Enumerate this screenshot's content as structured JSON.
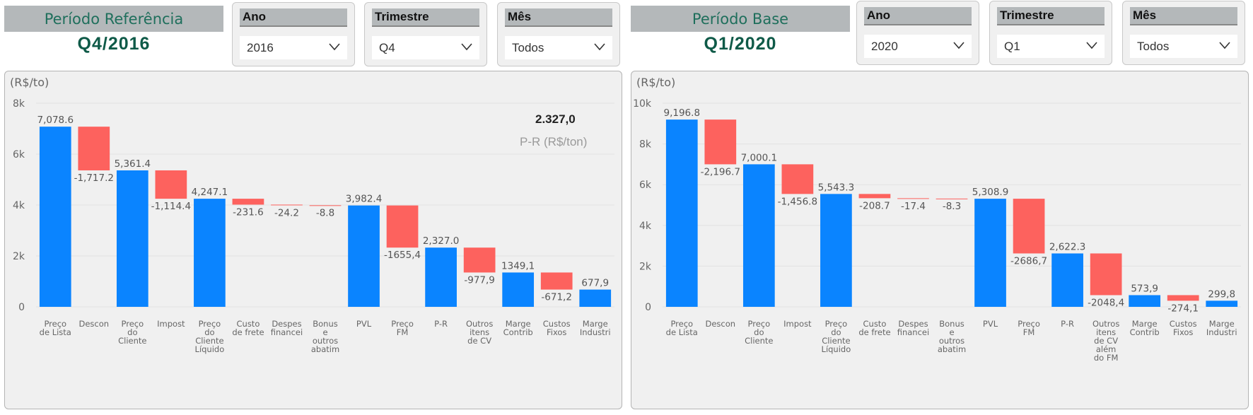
{
  "colors": {
    "increase": "#0a84ff",
    "decrease": "#fd625e",
    "title_bg": "#b4b8ba"
  },
  "left": {
    "title": "Período Referência",
    "period": "Q4/2016",
    "slicers": [
      {
        "header": "Ano",
        "value": "2016"
      },
      {
        "header": "Trimestre",
        "value": "Q4"
      },
      {
        "header": "Mês",
        "value": "Todos"
      }
    ],
    "kpi": {
      "value": "2.327,0",
      "label": "P-R (R$/ton)"
    }
  },
  "right": {
    "title": "Período Base",
    "period": "Q1/2020",
    "slicers": [
      {
        "header": "Ano",
        "value": "2020"
      },
      {
        "header": "Trimestre",
        "value": "Q1"
      },
      {
        "header": "Mês",
        "value": "Todos"
      }
    ]
  },
  "chart_data": [
    {
      "type": "waterfall",
      "unit_label": "(R$/to)",
      "ylim": [
        0,
        8000
      ],
      "yticks": [
        {
          "v": 0,
          "label": "0"
        },
        {
          "v": 2000,
          "label": "2k"
        },
        {
          "v": 4000,
          "label": "4k"
        },
        {
          "v": 6000,
          "label": "6k"
        },
        {
          "v": 8000,
          "label": "8k"
        }
      ],
      "grid": true,
      "bars": [
        {
          "category": [
            "Preço",
            "de Lista"
          ],
          "kind": "total",
          "value": 7078.6,
          "label": "7,078.6"
        },
        {
          "category": [
            "Descon"
          ],
          "kind": "delta",
          "value": -1717.2,
          "label": "-1,717.2"
        },
        {
          "category": [
            "Preço",
            "do",
            "Cliente"
          ],
          "kind": "total",
          "value": 5361.4,
          "label": "5,361.4"
        },
        {
          "category": [
            "Impost"
          ],
          "kind": "delta",
          "value": -1114.4,
          "label": "-1,114.4"
        },
        {
          "category": [
            "Preço",
            "do",
            "Cliente",
            "Líquido"
          ],
          "kind": "total",
          "value": 4247.1,
          "label": "4,247.1"
        },
        {
          "category": [
            "Custo",
            "de frete"
          ],
          "kind": "delta",
          "value": -231.6,
          "label": "-231.6"
        },
        {
          "category": [
            "Despes",
            "financei"
          ],
          "kind": "delta",
          "value": -24.2,
          "label": "-24.2"
        },
        {
          "category": [
            "Bonus",
            "e",
            "outros",
            "abatim"
          ],
          "kind": "delta",
          "value": -8.8,
          "label": "-8.8"
        },
        {
          "category": [
            "PVL"
          ],
          "kind": "total",
          "value": 3982.4,
          "label": "3,982.4"
        },
        {
          "category": [
            "Preço",
            "FM"
          ],
          "kind": "delta",
          "value": -1655.4,
          "label": "-1655,4"
        },
        {
          "category": [
            "P-R"
          ],
          "kind": "total",
          "value": 2327.0,
          "label": "2,327.0"
        },
        {
          "category": [
            "Outros",
            "itens",
            "de CV"
          ],
          "kind": "delta",
          "value": -977.9,
          "label": "-977,9"
        },
        {
          "category": [
            "Marge",
            "Contrib"
          ],
          "kind": "total",
          "value": 1349.1,
          "label": "1349,1"
        },
        {
          "category": [
            "Custos",
            "Fixos"
          ],
          "kind": "delta",
          "value": -671.2,
          "label": "-671,2"
        },
        {
          "category": [
            "Marge",
            "Industri"
          ],
          "kind": "total",
          "value": 677.9,
          "label": "677,9"
        }
      ]
    },
    {
      "type": "waterfall",
      "unit_label": "(R$/to)",
      "ylim": [
        0,
        10000
      ],
      "yticks": [
        {
          "v": 0,
          "label": "0"
        },
        {
          "v": 2000,
          "label": "2k"
        },
        {
          "v": 4000,
          "label": "4k"
        },
        {
          "v": 6000,
          "label": "6k"
        },
        {
          "v": 8000,
          "label": "8k"
        },
        {
          "v": 10000,
          "label": "10k"
        }
      ],
      "grid": true,
      "bars": [
        {
          "category": [
            "Preço",
            "de Lista"
          ],
          "kind": "total",
          "value": 9196.8,
          "label": "9,196.8"
        },
        {
          "category": [
            "Descon"
          ],
          "kind": "delta",
          "value": -2196.7,
          "label": "-2,196.7"
        },
        {
          "category": [
            "Preço",
            "do",
            "Cliente"
          ],
          "kind": "total",
          "value": 7000.1,
          "label": "7,000.1"
        },
        {
          "category": [
            "Impost"
          ],
          "kind": "delta",
          "value": -1456.8,
          "label": "-1,456.8"
        },
        {
          "category": [
            "Preço",
            "do",
            "Cliente",
            "Líquido"
          ],
          "kind": "total",
          "value": 5543.3,
          "label": "5,543.3"
        },
        {
          "category": [
            "Custo",
            "de frete"
          ],
          "kind": "delta",
          "value": -208.7,
          "label": "-208.7"
        },
        {
          "category": [
            "Despes",
            "financei"
          ],
          "kind": "delta",
          "value": -17.4,
          "label": "-17.4"
        },
        {
          "category": [
            "Bonus",
            "e",
            "outros",
            "abatim"
          ],
          "kind": "delta",
          "value": -8.3,
          "label": "-8.3"
        },
        {
          "category": [
            "PVL"
          ],
          "kind": "total",
          "value": 5308.9,
          "label": "5,308.9"
        },
        {
          "category": [
            "Preço",
            "FM"
          ],
          "kind": "delta",
          "value": -2686.7,
          "label": "-2686,7"
        },
        {
          "category": [
            "P-R"
          ],
          "kind": "total",
          "value": 2622.3,
          "label": "2,622.3"
        },
        {
          "category": [
            "Outros",
            "itens",
            "de CV",
            "além",
            "do FM"
          ],
          "kind": "delta",
          "value": -2048.4,
          "label": "-2048,4"
        },
        {
          "category": [
            "Marge",
            "Contrib"
          ],
          "kind": "total",
          "value": 573.9,
          "label": "573,9"
        },
        {
          "category": [
            "Custos",
            "Fixos"
          ],
          "kind": "delta",
          "value": -274.1,
          "label": "-274,1"
        },
        {
          "category": [
            "Marge",
            "Industri"
          ],
          "kind": "total",
          "value": 299.8,
          "label": "299,8"
        }
      ]
    }
  ]
}
